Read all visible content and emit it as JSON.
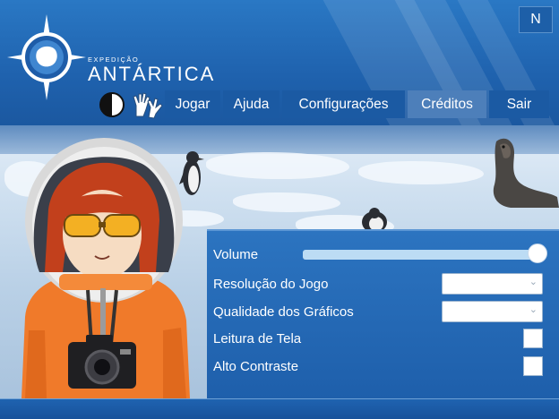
{
  "app": {
    "logo_small": "EXPEDIÇÃO",
    "logo_main": "ANTÁRTICA"
  },
  "top_button": "N",
  "menu": {
    "items": [
      {
        "label": "Jogar",
        "active": false
      },
      {
        "label": "Ajuda",
        "active": false
      },
      {
        "label": "Configurações",
        "active": false
      },
      {
        "label": "Créditos",
        "active": true
      },
      {
        "label": "Sair",
        "active": false
      }
    ]
  },
  "icons": {
    "contrast": "contrast-toggle-icon",
    "sign_language": "sign-language-hands-icon"
  },
  "settings": {
    "volume": {
      "label": "Volume",
      "level": 1.0
    },
    "resolution": {
      "label": "Resolução do Jogo",
      "value": ""
    },
    "graphics_quality": {
      "label": "Qualidade dos Gráficos",
      "value": ""
    },
    "screen_reader": {
      "label": "Leitura de Tela",
      "checked": false
    },
    "high_contrast": {
      "label": "Alto Contraste",
      "checked": false
    }
  },
  "colors": {
    "header_blue": "#2a78c4",
    "menu_button": "#1b5aa3",
    "menu_active": "#4d7fba",
    "panel_blue": "#2c74c0",
    "jacket_orange": "#f07a2a"
  }
}
